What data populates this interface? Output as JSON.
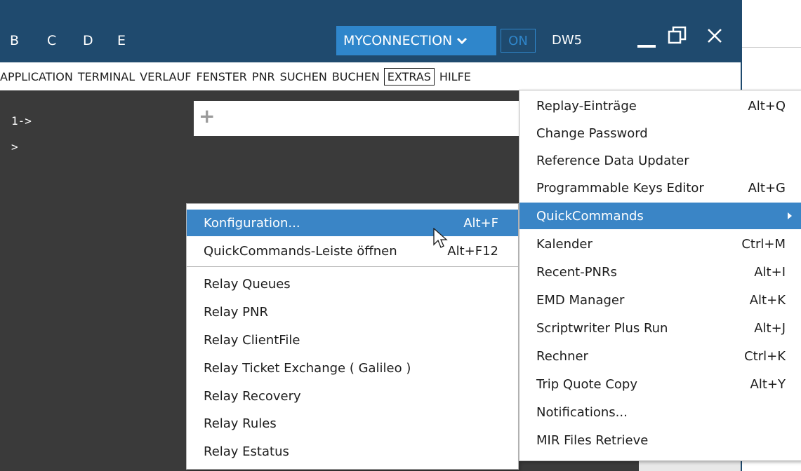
{
  "titlebar": {
    "letters": [
      "B",
      "C",
      "D",
      "E"
    ],
    "connection": "MYCONNECTION",
    "toggle": "ON",
    "host": "DW5",
    "minimize": "—",
    "restore": "❐",
    "close": "X",
    "bg_color": "#1f4a6e",
    "accent_color": "#2f86cb"
  },
  "menubar": {
    "items": [
      "APPLICATION",
      "TERMINAL",
      "VERLAUF",
      "FENSTER",
      "PNR",
      "SUCHEN",
      "BUCHEN",
      "EXTRAS",
      "HILFE"
    ],
    "active": "EXTRAS"
  },
  "terminal": {
    "line1": "1->",
    "line2": ">"
  },
  "extras_menu": {
    "items": [
      {
        "label": "Replay-Einträge",
        "shortcut": "Alt+Q"
      },
      {
        "label": "Change Password",
        "shortcut": ""
      },
      {
        "label": "Reference Data Updater",
        "shortcut": ""
      },
      {
        "label": "Programmable Keys Editor",
        "shortcut": "Alt+G"
      },
      {
        "label": "QuickCommands",
        "shortcut": "",
        "submenu": true,
        "highlighted": true
      },
      {
        "label": "Kalender",
        "shortcut": "Ctrl+M"
      },
      {
        "label": "Recent-PNRs",
        "shortcut": "Alt+I"
      },
      {
        "label": "EMD Manager",
        "shortcut": "Alt+K"
      },
      {
        "label": "Scriptwriter Plus Run",
        "shortcut": "Alt+J"
      },
      {
        "label": "Rechner",
        "shortcut": "Ctrl+K"
      },
      {
        "label": "Trip Quote Copy",
        "shortcut": "Alt+Y"
      },
      {
        "label": "Notifications...",
        "shortcut": ""
      },
      {
        "label": "MIR Files Retrieve",
        "shortcut": ""
      }
    ]
  },
  "quickcommands_menu": {
    "items": [
      {
        "label": "Konfiguration...",
        "shortcut": "Alt+F",
        "highlighted": true
      },
      {
        "label": "QuickCommands-Leiste öffnen",
        "shortcut": "Alt+F12"
      },
      {
        "label": "Relay Queues",
        "shortcut": ""
      },
      {
        "label": "Relay PNR",
        "shortcut": ""
      },
      {
        "label": "Relay ClientFile",
        "shortcut": ""
      },
      {
        "label": "Relay Ticket Exchange ( Galileo )",
        "shortcut": ""
      },
      {
        "label": "Relay Recovery",
        "shortcut": ""
      },
      {
        "label": "Relay Rules",
        "shortcut": ""
      },
      {
        "label": "Relay Estatus",
        "shortcut": ""
      }
    ]
  }
}
